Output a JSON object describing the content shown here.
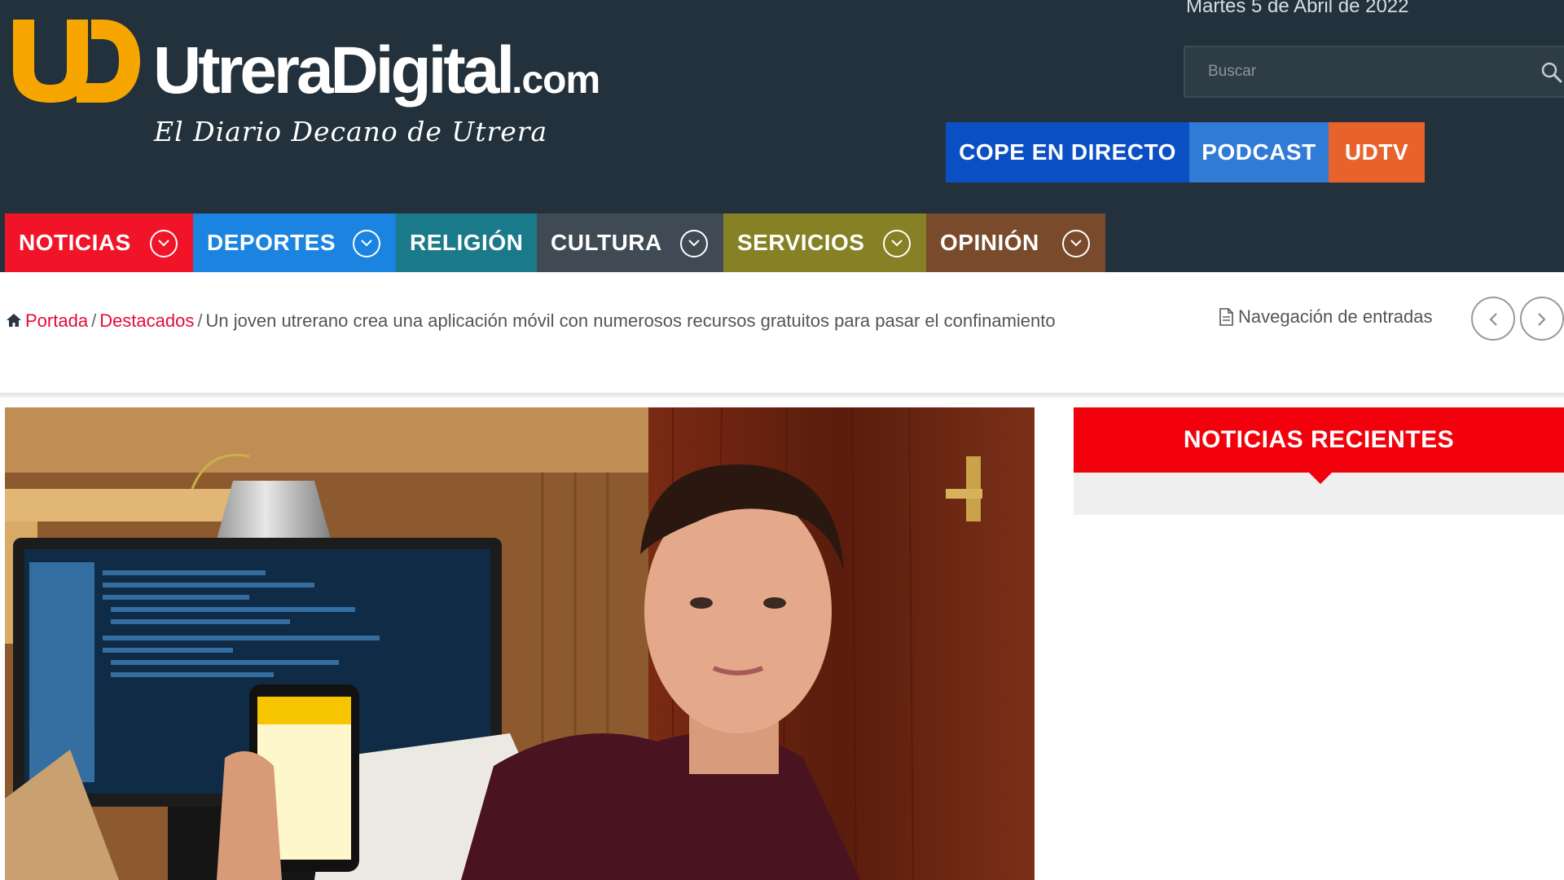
{
  "header": {
    "logo_text": "UtreraDigital",
    "logo_domain": ".com",
    "tagline": "El Diario Decano de Utrera",
    "date": "Martes 5 de Abril de 2022",
    "search_placeholder": "Buscar",
    "quick_links": [
      {
        "label": "COPE EN DIRECTO",
        "color": "#0a4fc4"
      },
      {
        "label": "PODCAST",
        "color": "#2f7bd6"
      },
      {
        "label": "UDTV",
        "color": "#e8632b"
      }
    ]
  },
  "nav": {
    "items": [
      {
        "label": "NOTICIAS",
        "color": "#f11428",
        "has_dropdown": true
      },
      {
        "label": "DEPORTES",
        "color": "#1b84e0",
        "has_dropdown": true
      },
      {
        "label": "RELIGIÓN",
        "color": "#1b7a8a",
        "has_dropdown": false
      },
      {
        "label": "CULTURA",
        "color": "#3f4a55",
        "has_dropdown": true
      },
      {
        "label": "SERVICIOS",
        "color": "#868124",
        "has_dropdown": true
      },
      {
        "label": "OPINIÓN",
        "color": "#7a4a2c",
        "has_dropdown": true
      }
    ]
  },
  "breadcrumb": {
    "home": "Portada",
    "section": "Destacados",
    "current": "Un joven utrerano crea una aplicación móvil con numerosos recursos gratuitos para pasar el confinamiento"
  },
  "entry_nav": {
    "label": "Navegación de entradas"
  },
  "sidebar": {
    "recent_title": "NOTICIAS RECIENTES"
  },
  "colors": {
    "header_bg": "#22313b",
    "accent_red": "#f2000b",
    "link_red": "#e30b3a",
    "logo_orange": "#f7a600"
  }
}
